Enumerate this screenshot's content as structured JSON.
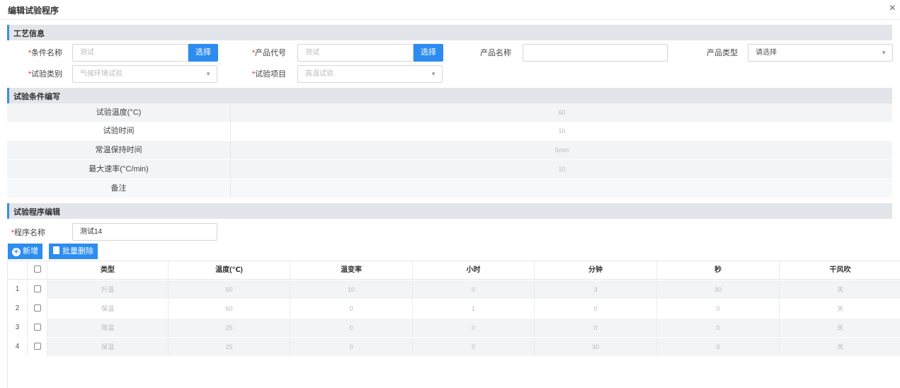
{
  "dialog": {
    "title": "编辑试验程序",
    "close": "×"
  },
  "process": {
    "header": "工艺信息",
    "condition_name": {
      "label": "条件名称",
      "value": "测试",
      "button": "选择"
    },
    "product_code": {
      "label": "产品代号",
      "value": "测试",
      "button": "选择"
    },
    "product_name": {
      "label": "产品名称",
      "value": ""
    },
    "product_type": {
      "label": "产品类型",
      "value": "请选择"
    },
    "test_category": {
      "label": "试验类别",
      "value": "气候环境试验"
    },
    "test_item": {
      "label": "试验项目",
      "value": "高温试验"
    }
  },
  "conditions": {
    "header": "试验条件编写",
    "rows": [
      {
        "key": "试验温度(°C)",
        "value": "60"
      },
      {
        "key": "试验时间",
        "value": "1h"
      },
      {
        "key": "常温保持时间",
        "value": "5min"
      },
      {
        "key": "最大速率(°C/min)",
        "value": "10"
      },
      {
        "key": "备注",
        "value": ""
      }
    ]
  },
  "program": {
    "header": "试验程序编辑",
    "name_label": "程序名称",
    "name_value": "测试14",
    "add_button": "新增",
    "batch_delete_button": "批量删除",
    "columns": [
      "类型",
      "温度(℃)",
      "温变率",
      "小时",
      "分钟",
      "秒",
      "干风吹"
    ],
    "rows": [
      {
        "num": "1",
        "cells": [
          "升温",
          "60",
          "10",
          "0",
          "3",
          "30",
          "关"
        ]
      },
      {
        "num": "2",
        "cells": [
          "保温",
          "60",
          "0",
          "1",
          "0",
          "0",
          "关"
        ]
      },
      {
        "num": "3",
        "cells": [
          "降温",
          "25",
          "0",
          "0",
          "0",
          "0",
          "关"
        ]
      },
      {
        "num": "4",
        "cells": [
          "保温",
          "25",
          "0",
          "0",
          "30",
          "0",
          "关"
        ]
      }
    ]
  }
}
